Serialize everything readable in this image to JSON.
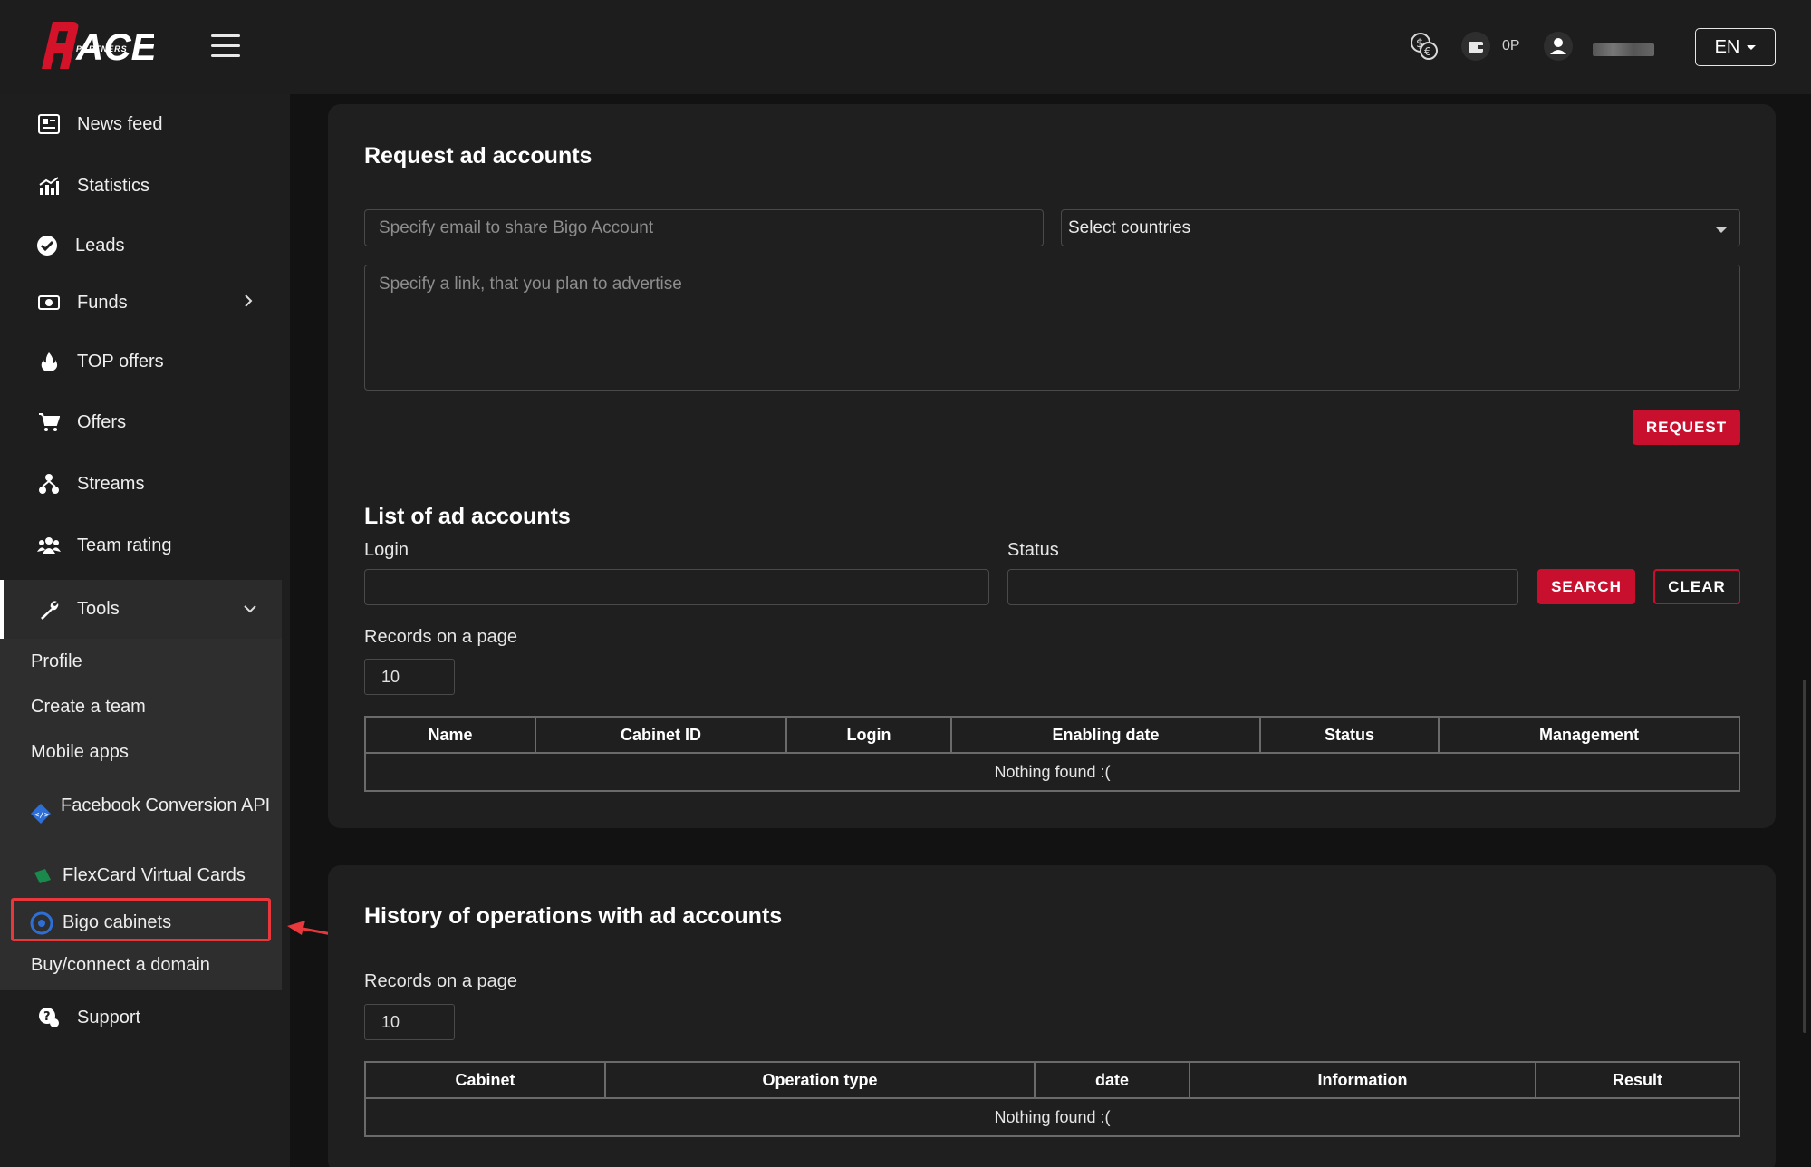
{
  "header": {
    "logo_text": "ACE",
    "logo_sub": "PARTNERS",
    "balance": "0P",
    "language": "EN",
    "icons": [
      "currency-exchange-icon",
      "wallet-icon",
      "user-icon"
    ]
  },
  "sidebar": {
    "items": [
      {
        "label": "News feed",
        "icon": "newspaper-icon"
      },
      {
        "label": "Statistics",
        "icon": "chart-icon"
      },
      {
        "label": "Leads",
        "icon": "check-circle-icon"
      },
      {
        "label": "Funds",
        "icon": "money-icon"
      },
      {
        "label": "TOP offers",
        "icon": "fire-icon"
      },
      {
        "label": "Offers",
        "icon": "cart-icon"
      },
      {
        "label": "Streams",
        "icon": "streams-icon"
      },
      {
        "label": "Team rating",
        "icon": "team-icon"
      },
      {
        "label": "Tools",
        "icon": "wrench-icon"
      }
    ],
    "tools_submenu": [
      {
        "label": "Profile"
      },
      {
        "label": "Create a team"
      },
      {
        "label": "Mobile apps"
      },
      {
        "label": "Facebook Conversion API"
      },
      {
        "label": "FlexCard Virtual Cards"
      },
      {
        "label": "Bigo cabinets"
      },
      {
        "label": "Buy/connect a domain"
      }
    ],
    "support": {
      "label": "Support",
      "icon": "support-icon"
    }
  },
  "request_card": {
    "title": "Request ad accounts",
    "email_placeholder": "Specify email to share Bigo Account",
    "countries_placeholder": "Select countries",
    "link_placeholder": "Specify a link, that you plan to advertise",
    "request_button": "REQUEST",
    "list_title": "List of ad accounts",
    "login_label": "Login",
    "status_label": "Status",
    "search_button": "SEARCH",
    "clear_button": "CLEAR",
    "records_label": "Records on a page",
    "records_value": "10",
    "table_headers": [
      "Name",
      "Cabinet ID",
      "Login",
      "Enabling date",
      "Status",
      "Management"
    ],
    "empty_text": "Nothing found :("
  },
  "history_card": {
    "title": "History of operations with ad accounts",
    "records_label": "Records on a page",
    "records_value": "10",
    "table_headers": [
      "Cabinet",
      "Operation type",
      "date",
      "Information",
      "Result"
    ],
    "empty_text": "Nothing found :("
  },
  "colors": {
    "accent": "#c8102e",
    "highlight": "#e8383c",
    "sidebar_bg": "#1e1e1e",
    "card_bg": "#1f1f1f",
    "page_bg": "#121212"
  }
}
